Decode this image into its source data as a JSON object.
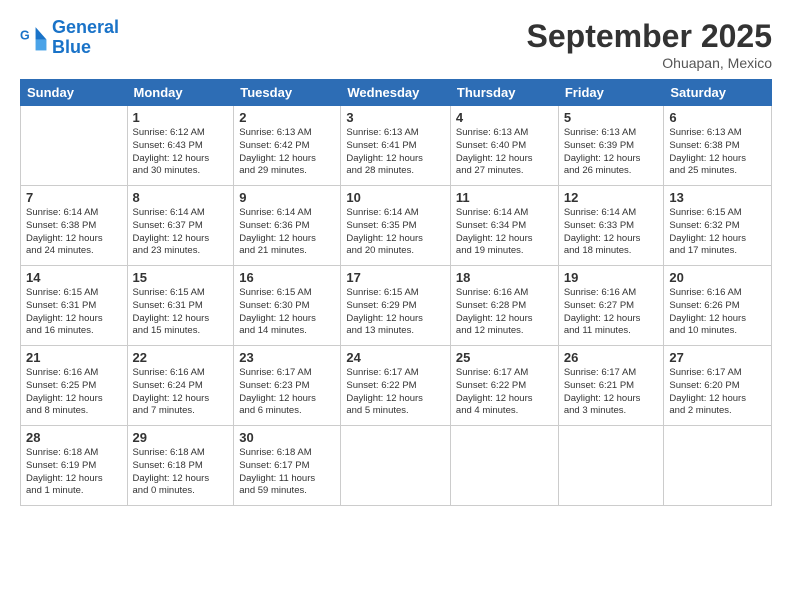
{
  "header": {
    "logo_line1": "General",
    "logo_line2": "Blue",
    "month_title": "September 2025",
    "location": "Ohuapan, Mexico"
  },
  "weekdays": [
    "Sunday",
    "Monday",
    "Tuesday",
    "Wednesday",
    "Thursday",
    "Friday",
    "Saturday"
  ],
  "weeks": [
    [
      {
        "day": "",
        "info": ""
      },
      {
        "day": "1",
        "info": "Sunrise: 6:12 AM\nSunset: 6:43 PM\nDaylight: 12 hours\nand 30 minutes."
      },
      {
        "day": "2",
        "info": "Sunrise: 6:13 AM\nSunset: 6:42 PM\nDaylight: 12 hours\nand 29 minutes."
      },
      {
        "day": "3",
        "info": "Sunrise: 6:13 AM\nSunset: 6:41 PM\nDaylight: 12 hours\nand 28 minutes."
      },
      {
        "day": "4",
        "info": "Sunrise: 6:13 AM\nSunset: 6:40 PM\nDaylight: 12 hours\nand 27 minutes."
      },
      {
        "day": "5",
        "info": "Sunrise: 6:13 AM\nSunset: 6:39 PM\nDaylight: 12 hours\nand 26 minutes."
      },
      {
        "day": "6",
        "info": "Sunrise: 6:13 AM\nSunset: 6:38 PM\nDaylight: 12 hours\nand 25 minutes."
      }
    ],
    [
      {
        "day": "7",
        "info": "Sunrise: 6:14 AM\nSunset: 6:38 PM\nDaylight: 12 hours\nand 24 minutes."
      },
      {
        "day": "8",
        "info": "Sunrise: 6:14 AM\nSunset: 6:37 PM\nDaylight: 12 hours\nand 23 minutes."
      },
      {
        "day": "9",
        "info": "Sunrise: 6:14 AM\nSunset: 6:36 PM\nDaylight: 12 hours\nand 21 minutes."
      },
      {
        "day": "10",
        "info": "Sunrise: 6:14 AM\nSunset: 6:35 PM\nDaylight: 12 hours\nand 20 minutes."
      },
      {
        "day": "11",
        "info": "Sunrise: 6:14 AM\nSunset: 6:34 PM\nDaylight: 12 hours\nand 19 minutes."
      },
      {
        "day": "12",
        "info": "Sunrise: 6:14 AM\nSunset: 6:33 PM\nDaylight: 12 hours\nand 18 minutes."
      },
      {
        "day": "13",
        "info": "Sunrise: 6:15 AM\nSunset: 6:32 PM\nDaylight: 12 hours\nand 17 minutes."
      }
    ],
    [
      {
        "day": "14",
        "info": "Sunrise: 6:15 AM\nSunset: 6:31 PM\nDaylight: 12 hours\nand 16 minutes."
      },
      {
        "day": "15",
        "info": "Sunrise: 6:15 AM\nSunset: 6:31 PM\nDaylight: 12 hours\nand 15 minutes."
      },
      {
        "day": "16",
        "info": "Sunrise: 6:15 AM\nSunset: 6:30 PM\nDaylight: 12 hours\nand 14 minutes."
      },
      {
        "day": "17",
        "info": "Sunrise: 6:15 AM\nSunset: 6:29 PM\nDaylight: 12 hours\nand 13 minutes."
      },
      {
        "day": "18",
        "info": "Sunrise: 6:16 AM\nSunset: 6:28 PM\nDaylight: 12 hours\nand 12 minutes."
      },
      {
        "day": "19",
        "info": "Sunrise: 6:16 AM\nSunset: 6:27 PM\nDaylight: 12 hours\nand 11 minutes."
      },
      {
        "day": "20",
        "info": "Sunrise: 6:16 AM\nSunset: 6:26 PM\nDaylight: 12 hours\nand 10 minutes."
      }
    ],
    [
      {
        "day": "21",
        "info": "Sunrise: 6:16 AM\nSunset: 6:25 PM\nDaylight: 12 hours\nand 8 minutes."
      },
      {
        "day": "22",
        "info": "Sunrise: 6:16 AM\nSunset: 6:24 PM\nDaylight: 12 hours\nand 7 minutes."
      },
      {
        "day": "23",
        "info": "Sunrise: 6:17 AM\nSunset: 6:23 PM\nDaylight: 12 hours\nand 6 minutes."
      },
      {
        "day": "24",
        "info": "Sunrise: 6:17 AM\nSunset: 6:22 PM\nDaylight: 12 hours\nand 5 minutes."
      },
      {
        "day": "25",
        "info": "Sunrise: 6:17 AM\nSunset: 6:22 PM\nDaylight: 12 hours\nand 4 minutes."
      },
      {
        "day": "26",
        "info": "Sunrise: 6:17 AM\nSunset: 6:21 PM\nDaylight: 12 hours\nand 3 minutes."
      },
      {
        "day": "27",
        "info": "Sunrise: 6:17 AM\nSunset: 6:20 PM\nDaylight: 12 hours\nand 2 minutes."
      }
    ],
    [
      {
        "day": "28",
        "info": "Sunrise: 6:18 AM\nSunset: 6:19 PM\nDaylight: 12 hours\nand 1 minute."
      },
      {
        "day": "29",
        "info": "Sunrise: 6:18 AM\nSunset: 6:18 PM\nDaylight: 12 hours\nand 0 minutes."
      },
      {
        "day": "30",
        "info": "Sunrise: 6:18 AM\nSunset: 6:17 PM\nDaylight: 11 hours\nand 59 minutes."
      },
      {
        "day": "",
        "info": ""
      },
      {
        "day": "",
        "info": ""
      },
      {
        "day": "",
        "info": ""
      },
      {
        "day": "",
        "info": ""
      }
    ]
  ]
}
